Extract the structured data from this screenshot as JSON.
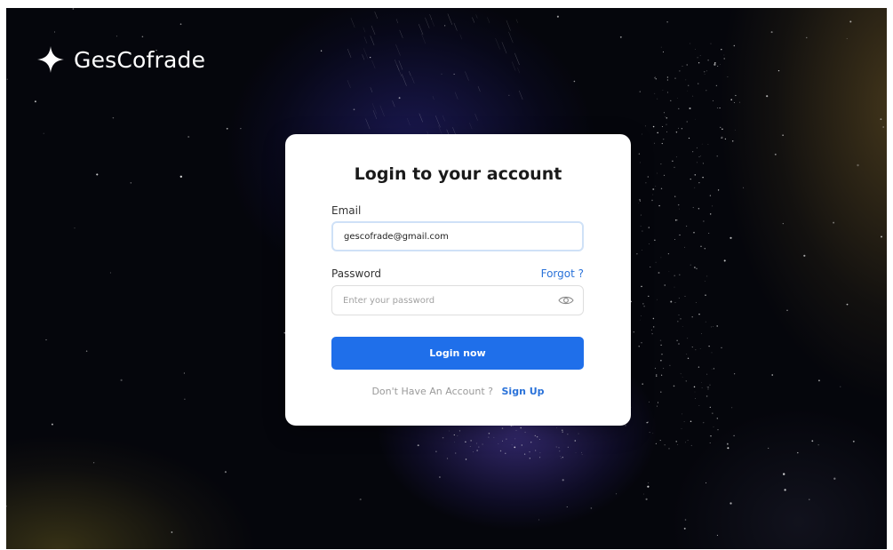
{
  "brand": {
    "name": "GesCofrade",
    "logo_icon": "four-point-star-icon"
  },
  "login": {
    "title": "Login to your account",
    "email_label": "Email",
    "email_value": "gescofrade@gmail.com",
    "password_label": "Password",
    "forgot_label": "Forgot ?",
    "password_placeholder": "Enter your password",
    "password_toggle_icon": "eye-icon",
    "submit_label": "Login now",
    "signup_prompt": "Don't Have An Account ?",
    "signup_label": "Sign Up"
  },
  "colors": {
    "accent": "#1f6fea",
    "link": "#2a72d9",
    "background": "#05060c",
    "card": "#ffffff"
  }
}
